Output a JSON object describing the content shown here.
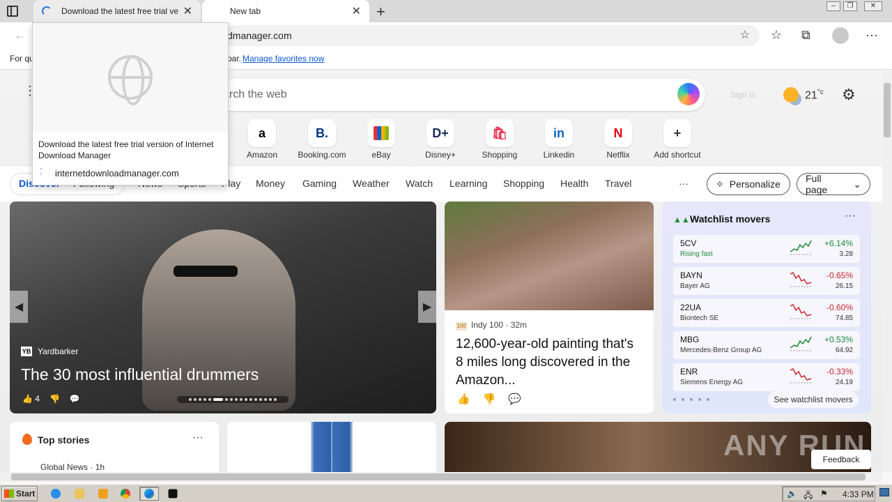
{
  "tabs": [
    {
      "title": "Download the latest free trial ve"
    },
    {
      "title": "New tab"
    }
  ],
  "address": {
    "url_visible": "dmanager.com"
  },
  "favbar": {
    "prefix": "For qu",
    "suffix": "bar.",
    "link": "Manage favorites now"
  },
  "search": {
    "placeholder": "arch the web"
  },
  "header": {
    "signin": "Sign in",
    "temperature": "21",
    "temp_unit": "°c"
  },
  "shortcuts": [
    {
      "label": "Amazon",
      "glyph": "a",
      "color": "#000000"
    },
    {
      "label": "Booking.com",
      "glyph": "B.",
      "color": "#003580"
    },
    {
      "label": "eBay",
      "glyph": "",
      "color": "#e53238"
    },
    {
      "label": "Disney+",
      "glyph": "D+",
      "color": "#1b2d55"
    },
    {
      "label": "Shopping",
      "glyph": "🛍",
      "color": "#e8334f"
    },
    {
      "label": "Linkedin",
      "glyph": "in",
      "color": "#0a66c2"
    },
    {
      "label": "Netflix",
      "glyph": "N",
      "color": "#e50914"
    },
    {
      "label": "Add shortcut",
      "glyph": "+",
      "color": "#333333"
    }
  ],
  "nav": {
    "items": [
      "Discover",
      "Following",
      "News",
      "Sports",
      "Play",
      "Money",
      "Gaming",
      "Weather",
      "Watch",
      "Learning",
      "Shopping",
      "Health",
      "Travel"
    ],
    "more": "···",
    "personalize": "Personalize",
    "fullpage": "Full page"
  },
  "hero": {
    "source": "Yardbarker",
    "source_logo": "YB",
    "headline": "The 30 most influential drummers",
    "likes": "4"
  },
  "story": {
    "source_badge": "100",
    "source": "Indy 100 · 32m",
    "headline": "12,600-year-old painting that's 8 miles long discovered in the Amazon..."
  },
  "watchlist": {
    "title": "Watchlist movers",
    "more": "···",
    "rows": [
      {
        "sym": "5CV",
        "name": "Rising fast",
        "change": "+6.14%",
        "price": "3.28",
        "dir": "up"
      },
      {
        "sym": "BAYN",
        "name": "Bayer AG",
        "change": "-0.65%",
        "price": "26.15",
        "dir": "down"
      },
      {
        "sym": "22UA",
        "name": "Biontech SE",
        "change": "-0.60%",
        "price": "74.85",
        "dir": "down"
      },
      {
        "sym": "MBG",
        "name": "Mercedes-Benz Group AG",
        "change": "+0.53%",
        "price": "64.92",
        "dir": "up"
      },
      {
        "sym": "ENR",
        "name": "Siemens Energy AG",
        "change": "-0.33%",
        "price": "24.19",
        "dir": "down"
      }
    ],
    "see_more": "See watchlist movers"
  },
  "topstories": {
    "title": "Top stories",
    "more": "···",
    "source": "Global News · 1h"
  },
  "watermark": "ANY RUN",
  "feedback": "Feedback",
  "popup": {
    "title": "Download the latest free trial version of Internet Download Manager",
    "url": "internetdownloadmanager.com"
  },
  "taskbar": {
    "start": "Start",
    "clock": "4:33 PM"
  },
  "colors": {
    "accent": "#0b57d0",
    "up": "#1d8a3a",
    "down": "#c8262d"
  }
}
